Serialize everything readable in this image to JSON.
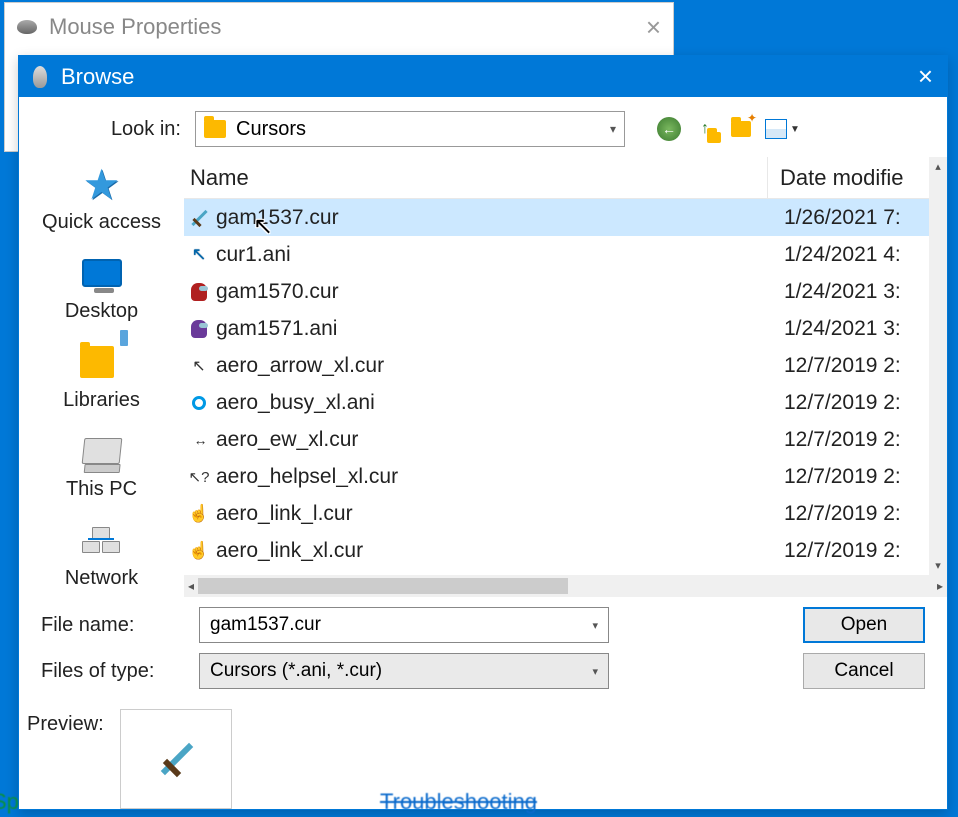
{
  "parent_window": {
    "title": "Mouse Properties"
  },
  "dialog": {
    "title": "Browse",
    "lookin_label": "Look in:",
    "lookin_value": "Cursors",
    "places": {
      "quick_access": "Quick access",
      "desktop": "Desktop",
      "libraries": "Libraries",
      "this_pc": "This PC",
      "network": "Network"
    },
    "columns": {
      "name": "Name",
      "date": "Date modifie"
    },
    "files": [
      {
        "name": "gam1537.cur",
        "date": "1/26/2021 7:",
        "icon": "sword",
        "selected": true
      },
      {
        "name": "cur1.ani",
        "date": "1/24/2021 4:",
        "icon": "cursor-blue",
        "selected": false
      },
      {
        "name": "gam1570.cur",
        "date": "1/24/2021 3:",
        "icon": "among-red",
        "selected": false
      },
      {
        "name": "gam1571.ani",
        "date": "1/24/2021 3:",
        "icon": "among-purple",
        "selected": false
      },
      {
        "name": "aero_arrow_xl.cur",
        "date": "12/7/2019 2:",
        "icon": "arrow",
        "selected": false
      },
      {
        "name": "aero_busy_xl.ani",
        "date": "12/7/2019 2:",
        "icon": "busy",
        "selected": false
      },
      {
        "name": "aero_ew_xl.cur",
        "date": "12/7/2019 2:",
        "icon": "ew",
        "selected": false
      },
      {
        "name": "aero_helpsel_xl.cur",
        "date": "12/7/2019 2:",
        "icon": "help",
        "selected": false
      },
      {
        "name": "aero_link_l.cur",
        "date": "12/7/2019 2:",
        "icon": "link",
        "selected": false
      },
      {
        "name": "aero_link_xl.cur",
        "date": "12/7/2019 2:",
        "icon": "link",
        "selected": false
      }
    ],
    "filename_label": "File name:",
    "filename_value": "gam1537.cur",
    "filetype_label": "Files of type:",
    "filetype_value": "Cursors (*.ani, *.cur)",
    "open_label": "Open",
    "cancel_label": "Cancel",
    "preview_label": "Preview:"
  }
}
